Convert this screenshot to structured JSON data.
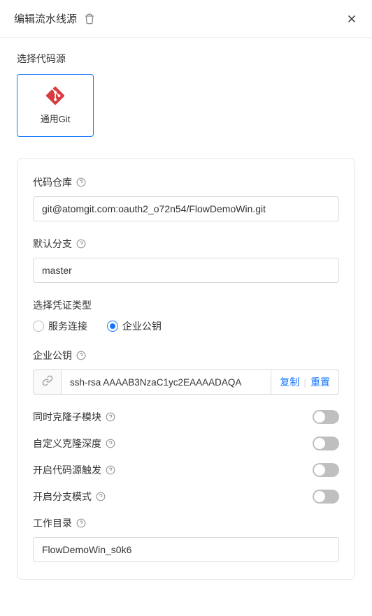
{
  "header": {
    "title": "编辑流水线源"
  },
  "source": {
    "section_label": "选择代码源",
    "card_label": "通用Git"
  },
  "repo": {
    "label": "代码仓库",
    "value": "git@atomgit.com:oauth2_o72n54/FlowDemoWin.git"
  },
  "branch": {
    "label": "默认分支",
    "value": "master"
  },
  "cred": {
    "label": "选择凭证类型",
    "options": [
      "服务连接",
      "企业公钥"
    ],
    "selected": 1
  },
  "pubkey": {
    "label": "企业公钥",
    "value": "ssh-rsa AAAAB3NzaC1yc2EAAAADAQA",
    "copy": "复制",
    "reset": "重置"
  },
  "toggles": {
    "submodule": "同时克隆子模块",
    "clonedepth": "自定义克隆深度",
    "trigger": "开启代码源触发",
    "branchmode": "开启分支模式"
  },
  "workdir": {
    "label": "工作目录",
    "value": "FlowDemoWin_s0k6"
  }
}
